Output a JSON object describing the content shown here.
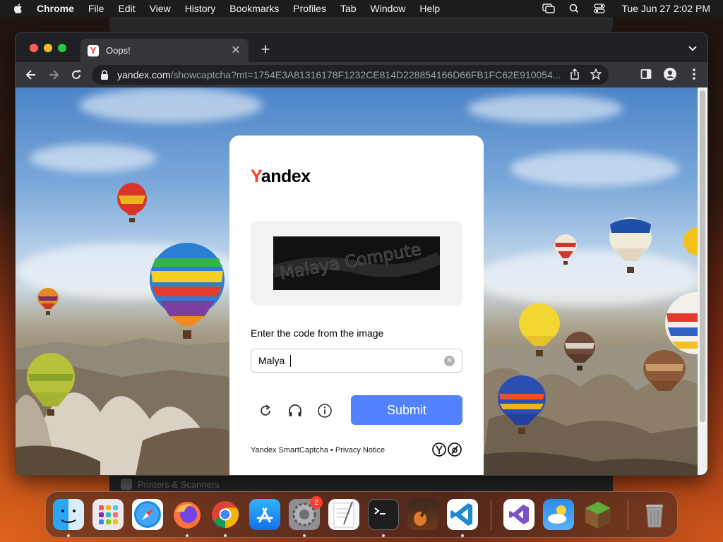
{
  "menubar": {
    "app_name": "Chrome",
    "items": [
      "File",
      "Edit",
      "View",
      "History",
      "Bookmarks",
      "Profiles",
      "Tab",
      "Window",
      "Help"
    ],
    "clock": "Tue Jun 27  2:02 PM"
  },
  "background_window": {
    "ghost_label": "Printers & Scanners"
  },
  "browser": {
    "tab_title": "Oops!",
    "url_host": "yandex.com",
    "url_path": "/showcaptcha?mt=1754E3A81316178F1232CE814D228854166D66FB1FC62E910054..."
  },
  "captcha": {
    "logo_first": "Y",
    "logo_rest": "andex",
    "captcha_text": "Malaya Compute",
    "prompt": "Enter the code from the image",
    "input_value": "Malya ",
    "submit_label": "Submit",
    "footer": "Yandex SmartCaptcha • Privacy Notice",
    "accent_color": "#5282ff",
    "brand_color": "#fc3f1d"
  },
  "dock": {
    "apps": [
      "Finder",
      "Launchpad",
      "Safari",
      "Firefox",
      "Google Chrome",
      "App Store",
      "System Settings",
      "TextEdit",
      "Terminal",
      "GarageBand",
      "Visual Studio Code",
      "Visual Studio",
      "Weather",
      "Minecraft",
      "Trash"
    ],
    "settings_badge": "2"
  }
}
